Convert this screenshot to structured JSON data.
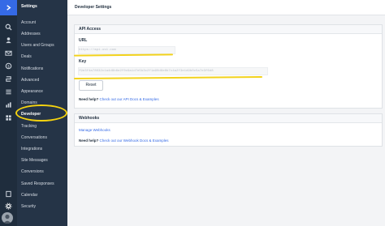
{
  "rail": {
    "icons": [
      "logo-icon",
      "search-icon",
      "contacts-icon",
      "mail-icon",
      "deals-icon",
      "automation-icon",
      "lists-icon",
      "reports-icon",
      "apps-icon",
      "pages-icon",
      "settings-icon"
    ]
  },
  "nav": {
    "title": "Settings",
    "items": [
      {
        "label": "Account",
        "active": false
      },
      {
        "label": "Addresses",
        "active": false
      },
      {
        "label": "Users and Groups",
        "active": false
      },
      {
        "label": "Deals",
        "active": false
      },
      {
        "label": "Notifications",
        "active": false
      },
      {
        "label": "Advanced",
        "active": false
      },
      {
        "label": "Appearance",
        "active": false
      },
      {
        "label": "Domains",
        "active": false
      },
      {
        "label": "Developer",
        "active": true
      },
      {
        "label": "Tracking",
        "active": false
      },
      {
        "label": "Conversations",
        "active": false
      },
      {
        "label": "Integrations",
        "active": false
      },
      {
        "label": "Site Messages",
        "active": false
      },
      {
        "label": "Conversions",
        "active": false
      },
      {
        "label": "Saved Responses",
        "active": false
      },
      {
        "label": "Calendar",
        "active": false
      },
      {
        "label": "Security",
        "active": false
      }
    ]
  },
  "page": {
    "title": "Developer Settings"
  },
  "api": {
    "header": "API Access",
    "url_label": "URL",
    "url_value": "https://api-us1.com",
    "key_label": "Key",
    "key_value": "f9e3f4a78032c1a4d8b6e2f0c9a1d7e5b3c2f1a90d6e8b7c4a2f3e1d9b0c5a7e3f6d8",
    "reset_label": "Reset",
    "help_bold": "Need help?",
    "help_link": "Check out our API Docs & Examples"
  },
  "webhooks": {
    "header": "Webhooks",
    "manage_link": "Manage Webhooks",
    "help_bold": "Need help?",
    "help_link": "Check out our Webhook Docs & Examples"
  },
  "colors": {
    "rail": "#1f2d3d",
    "nav": "#253447",
    "accent": "#356ae6",
    "annotation": "#f2d21c"
  }
}
